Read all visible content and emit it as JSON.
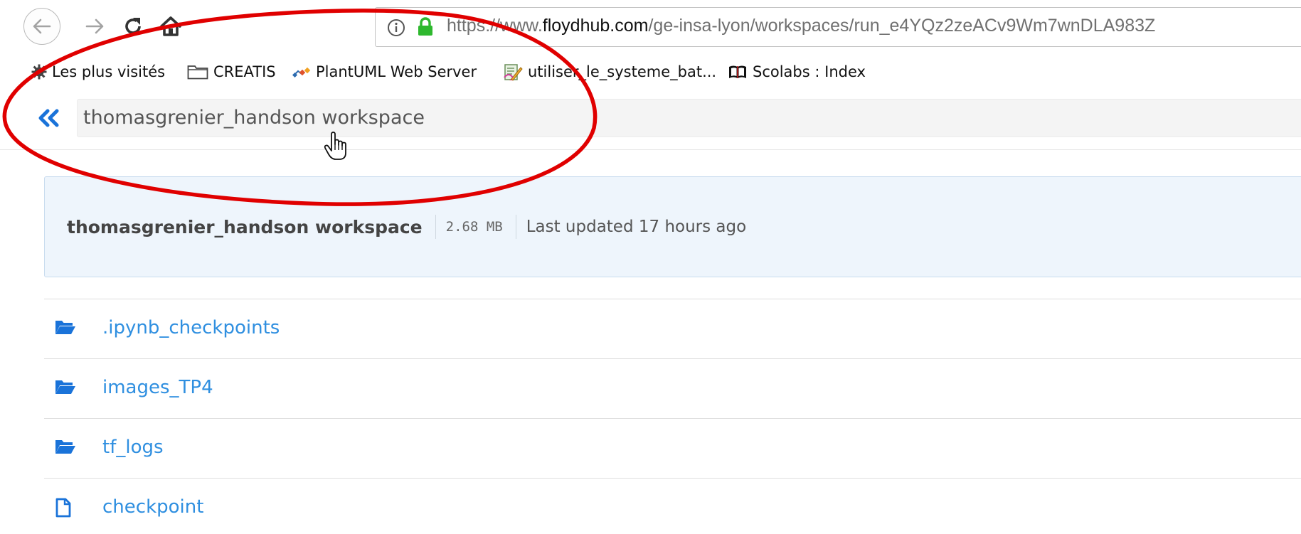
{
  "browser": {
    "url_prefix": "https://www.",
    "url_domain": "floydhub.com",
    "url_path": "/ge-insa-lyon/workspaces/run_e4YQz2zeACv9Wm7wnDLA983Z",
    "icons": [
      "back-icon",
      "forward-icon",
      "reload-icon",
      "home-icon",
      "info-icon",
      "lock-icon"
    ],
    "accent_colors": {
      "lock": "#2eb82e",
      "annotation": "#e00000"
    }
  },
  "bookmarks": {
    "items": [
      {
        "label": "Les plus visités",
        "icon": "gear-icon"
      },
      {
        "label": "CREATIS",
        "icon": "folder-icon"
      },
      {
        "label": "PlantUML Web Server",
        "icon": "plantuml-icon"
      },
      {
        "label": "utiliser_le_systeme_bat...",
        "icon": "document-edit-icon"
      },
      {
        "label": "Scolabs : Index",
        "icon": "book-icon"
      }
    ]
  },
  "app": {
    "workspace_title": "thomasgrenier_handson workspace"
  },
  "info_panel": {
    "name": "thomasgrenier_handson workspace",
    "size": "2.68 MB",
    "last_updated": "Last updated 17 hours ago"
  },
  "files": [
    {
      "name": ".ipynb_checkpoints",
      "type": "folder"
    },
    {
      "name": "images_TP4",
      "type": "folder"
    },
    {
      "name": "tf_logs",
      "type": "folder"
    },
    {
      "name": "checkpoint",
      "type": "file"
    }
  ],
  "colors": {
    "link": "#2f8fe0",
    "panel_bg": "#eef5fc",
    "panel_border": "#c8dbee"
  }
}
